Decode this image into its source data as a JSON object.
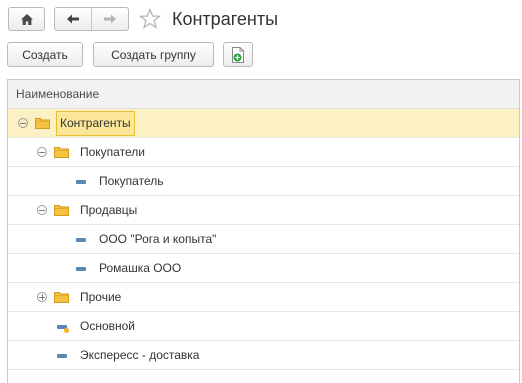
{
  "header": {
    "title": "Контрагенты",
    "icons": {
      "home": "home-icon",
      "back": "arrow-left-icon",
      "forward": "arrow-right-icon",
      "favorite": "star-icon"
    }
  },
  "toolbar": {
    "create_label": "Создать",
    "create_group_label": "Создать группу",
    "add_icon": "add-document-icon"
  },
  "grid": {
    "column_header": "Наименование",
    "rows": [
      {
        "label": "Контрагенты",
        "kind": "group",
        "level": 0,
        "state": "expanded",
        "selected": true
      },
      {
        "label": "Покупатели",
        "kind": "group",
        "level": 1,
        "state": "expanded"
      },
      {
        "label": "Покупатель",
        "kind": "item",
        "level": 2
      },
      {
        "label": "Продавцы",
        "kind": "group",
        "level": 1,
        "state": "expanded"
      },
      {
        "label": "ООО \"Рога и копыта\"",
        "kind": "item",
        "level": 2
      },
      {
        "label": "Ромашка ООО",
        "kind": "item",
        "level": 2
      },
      {
        "label": "Прочие",
        "kind": "group",
        "level": 1,
        "state": "collapsed"
      },
      {
        "label": "Основной",
        "kind": "item-marked",
        "level": 1
      },
      {
        "label": "Экспересс - доставка",
        "kind": "item",
        "level": 1
      }
    ]
  },
  "colors": {
    "selection": "#fbf1c4",
    "selection_border": "#e9bf34",
    "folder": "#f5c242",
    "item_marker": "#5b87b5",
    "marker_dot": "#f2b51b"
  }
}
